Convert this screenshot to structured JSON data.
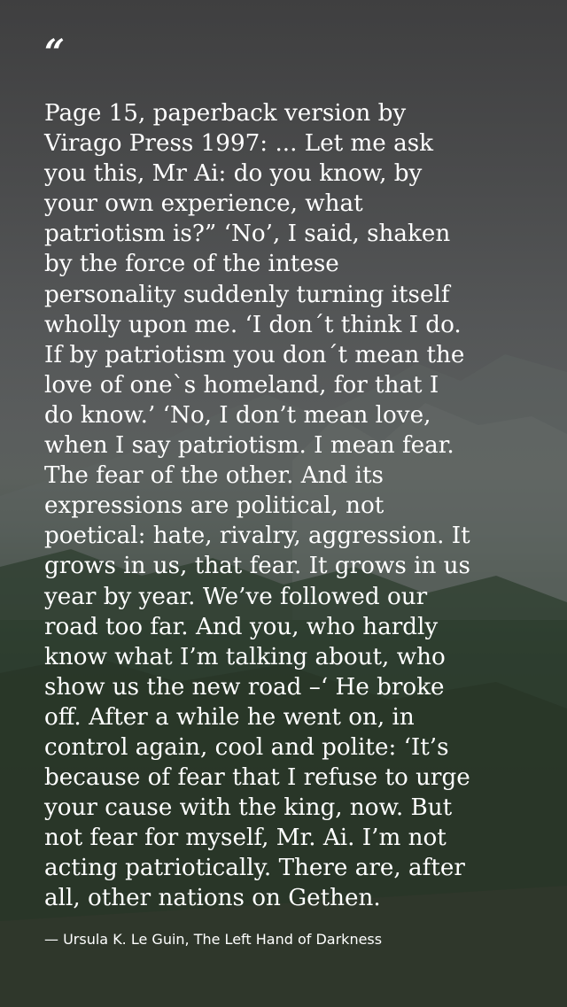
{
  "quote": {
    "mark": "“",
    "lines": [
      "Page 15, paperback version by",
      "Virago Press 1997: ... Let me ask",
      "you this, Mr Ai: do you know, by",
      "your own experience, what",
      "patriotism is?” ‘No’, I said, shaken",
      "by the force of the intese",
      "personality suddenly turning itself",
      "wholly upon me. ‘I don´t think I do.",
      "If by patriotism you don´t mean the",
      "love of one`s homeland, for that I",
      "do know.’ ‘No, I don’t mean love,",
      "when I say patriotism. I mean fear.",
      "The fear of the other. And its",
      "expressions are political, not",
      "poetical: hate, rivalry, aggression. It",
      "grows in us, that fear. It grows in us",
      "year by year. We’ve followed our",
      "road too far. And you, who hardly",
      "know what I’m talking about, who",
      "show us the new road –‘ He broke",
      "off. After a while he went on, in",
      "control again, cool and polite: ‘It’s",
      "because of fear that I refuse to urge",
      "your cause with the king, now. But",
      "not fear for myself, Mr. Ai. I’m not",
      "acting patriotically. There are, after",
      "all, other nations on Gethen."
    ],
    "attribution": "— Ursula K. Le Guin, The Left Hand of Darkness"
  },
  "colors": {
    "text": "#ffffff",
    "overlay": "#404040"
  }
}
